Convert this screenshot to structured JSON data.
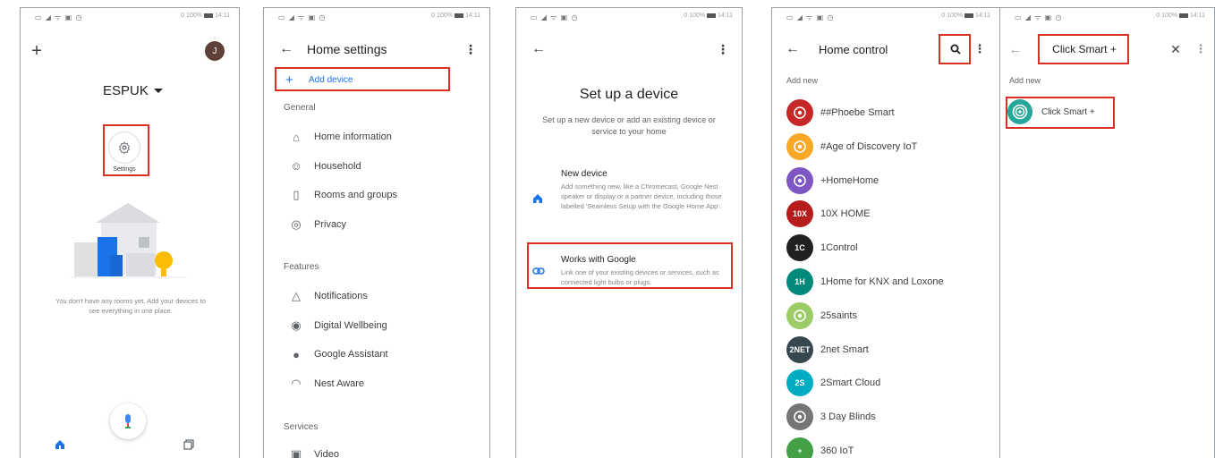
{
  "status_bar": {
    "left": "▭ ◢ ᯤ ▣ ◷",
    "right_text": "0 100%",
    "time": "14:11"
  },
  "panel1": {
    "add_label": "+",
    "avatar_initial": "J",
    "home_name": "ESPUK",
    "settings_label": "Settings",
    "empty_text": "You don't have any rooms yet. Add your devices to see everything in one place."
  },
  "panel2": {
    "title": "Home settings",
    "add_device": "Add device",
    "general_header": "General",
    "general_items": [
      {
        "label": "Home information",
        "icon": "home-outline"
      },
      {
        "label": "Household",
        "icon": "people"
      },
      {
        "label": "Rooms and groups",
        "icon": "door"
      },
      {
        "label": "Privacy",
        "icon": "shield"
      }
    ],
    "features_header": "Features",
    "features_items": [
      {
        "label": "Notifications",
        "icon": "bell"
      },
      {
        "label": "Digital Wellbeing",
        "icon": "wellbeing"
      },
      {
        "label": "Google Assistant",
        "icon": "assistant"
      },
      {
        "label": "Nest Aware",
        "icon": "nest"
      }
    ],
    "services_header": "Services",
    "services_items": [
      {
        "label": "Video",
        "icon": "video"
      }
    ]
  },
  "panel3": {
    "title": "Set up a device",
    "subtitle": "Set up a new device or add an existing device or service to your home",
    "new_device_title": "New device",
    "new_device_desc": "Add something new, like a Chromecast, Google Nest speaker or display or a partner device, including those labelled 'Seamless Setup with the Google Home App'.",
    "works_title": "Works with Google",
    "works_desc": "Link one of your existing devices or services, such as connected light bulbs or plugs."
  },
  "panel4": {
    "title": "Home control",
    "add_new": "Add new",
    "brands": [
      {
        "name": "##Phoebe Smart",
        "logo_text": "",
        "color": "#c62828"
      },
      {
        "name": "#Age of Discovery IoT",
        "logo_text": "",
        "color": "#f9a825"
      },
      {
        "name": "+HomeHome",
        "logo_text": "",
        "color": "#7e57c2"
      },
      {
        "name": "10X HOME",
        "logo_text": "10X",
        "color": "#b71c1c"
      },
      {
        "name": "1Control",
        "logo_text": "1C",
        "color": "#212121"
      },
      {
        "name": "1Home for KNX and Loxone",
        "logo_text": "1H",
        "color": "#00897b"
      },
      {
        "name": "25saints",
        "logo_text": "",
        "color": "#9ccc65"
      },
      {
        "name": "2net Smart",
        "logo_text": "2NET",
        "color": "#37474f"
      },
      {
        "name": "2Smart Cloud",
        "logo_text": "2S",
        "color": "#00acc1"
      },
      {
        "name": "3 Day Blinds",
        "logo_text": "",
        "color": "#757575"
      },
      {
        "name": "360 IoT",
        "logo_text": "+",
        "color": "#43a047"
      }
    ]
  },
  "panel5": {
    "search_value": "Click Smart +",
    "add_new": "Add new",
    "result_name": "Click Smart +",
    "result_color": "#26a69a"
  }
}
